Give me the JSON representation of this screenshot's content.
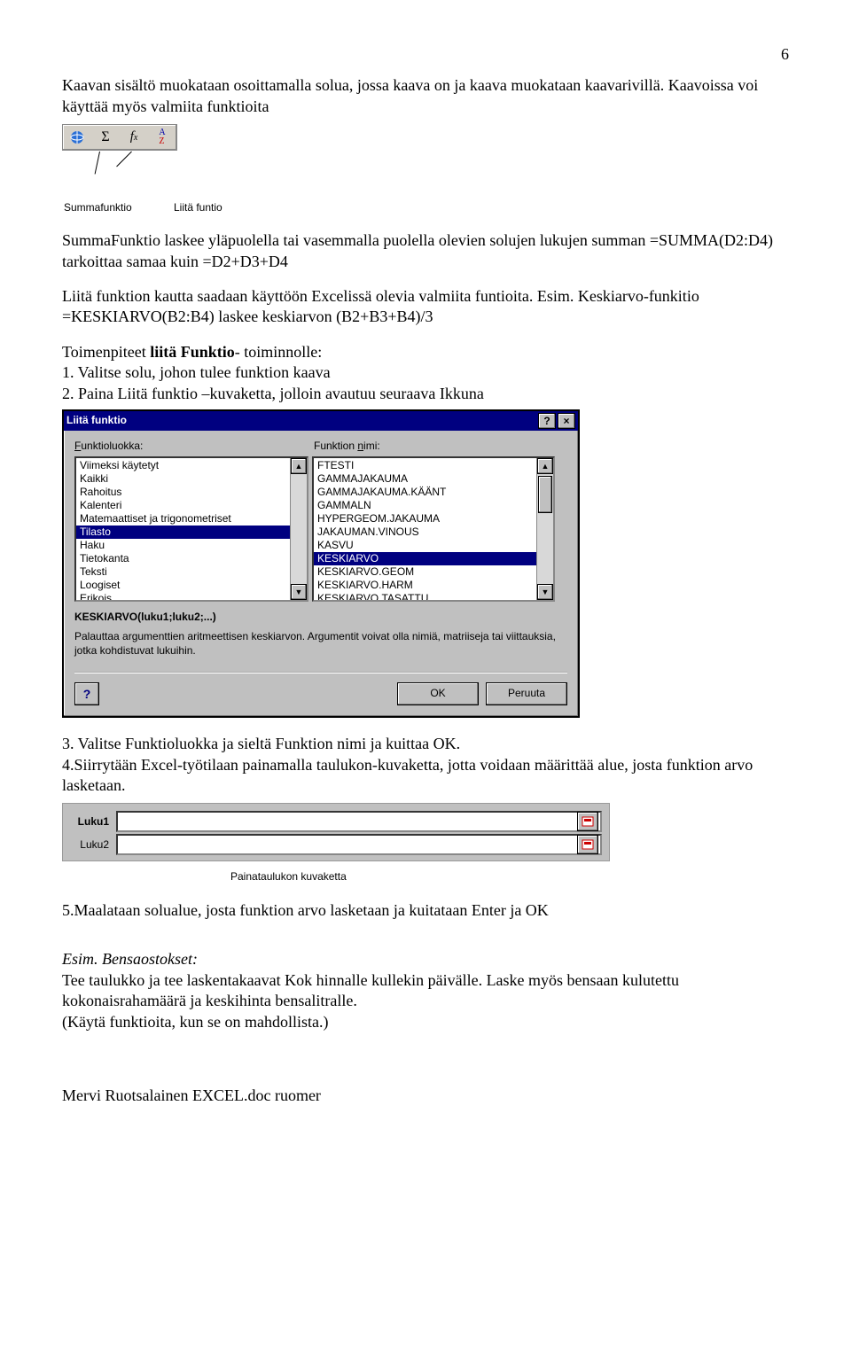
{
  "page_number": "6",
  "para1": "Kaavan sisältö muokataan osoittamalla solua, jossa kaava on ja kaava muokataan kaavarivillä. Kaavoissa voi käyttää myös valmiita funktioita",
  "toolbar_labels": {
    "summa": "Summafunktio",
    "liita": "Liitä funtio"
  },
  "summa_desc": "SummaFunktio laskee yläpuolella tai vasemmalla puolella olevien solujen lukujen summan =SUMMA(D2:D4)  tarkoittaa samaa kuin =D2+D3+D4",
  "liita_desc": "Liitä funktion kautta saadaan käyttöön Excelissä olevia valmiita funtioita. Esim. Keskiarvo-funkitio =KESKIARVO(B2:B4) laskee keskiarvon (B2+B3+B4)/3",
  "steps_title": "Toimenpiteet liitä Funktio- toiminnolle:",
  "steps_title_prefix": "Toimenpiteet ",
  "steps_title_bold": "liitä Funktio",
  "steps_title_suffix": "- toiminnolle:",
  "step1": "1. Valitse solu, johon tulee funktion kaava",
  "step2": "2. Paina Liitä funktio –kuvaketta, jolloin avautuu seuraava Ikkuna",
  "dialog": {
    "title": "Liitä funktio",
    "label_category": "Funktioluokka:",
    "label_name": "Funktion nimi:",
    "categories": [
      "Viimeksi käytetyt",
      "Kaikki",
      "Rahoitus",
      "Kalenteri",
      "Matemaattiset ja trigonometriset",
      "Tilasto",
      "Haku",
      "Tietokanta",
      "Teksti",
      "Loogiset",
      "Erikois"
    ],
    "selected_category_index": 5,
    "functions": [
      "FTESTI",
      "GAMMAJAKAUMA",
      "GAMMAJAKAUMA.KÄÄNT",
      "GAMMALN",
      "HYPERGEOM.JAKAUMA",
      "JAKAUMAN.VINOUS",
      "KASVU",
      "KESKIARVO",
      "KESKIARVO.GEOM",
      "KESKIARVO.HARM",
      "KESKIARVO.TASATTU"
    ],
    "selected_function_index": 7,
    "syntax": "KESKIARVO(luku1;luku2;...)",
    "description": "Palauttaa argumenttien aritmeettisen keskiarvon. Argumentit voivat olla nimiä, matriiseja tai viittauksia, jotka kohdistuvat lukuihin.",
    "ok": "OK",
    "cancel": "Peruuta",
    "help": "?"
  },
  "step3": "3. Valitse Funktioluokka ja sieltä Funktion nimi ja kuittaa OK.",
  "step4": "4.Siirrytään Excel-työtilaan painamalla taulukon-kuvaketta, jotta voidaan määrittää alue, josta funktion arvo lasketaan.",
  "luku": {
    "label1": "Luku1",
    "label2": "Luku2",
    "caption": "Painataulukon kuvaketta"
  },
  "step5": "5.Maalataan solualue, josta funktion arvo lasketaan ja kuitataan Enter ja OK",
  "example_title": "Esim. Bensaostokset:",
  "example_body": "Tee taulukko ja tee laskentakaavat Kok hinnalle kullekin päivälle. Laske myös bensaan kulutettu kokonaisrahamäärä ja keskihinta bensalitralle.",
  "example_note": "(Käytä funktioita, kun se on mahdollista.)",
  "footer": "Mervi Ruotsalainen EXCEL.doc   ruomer"
}
